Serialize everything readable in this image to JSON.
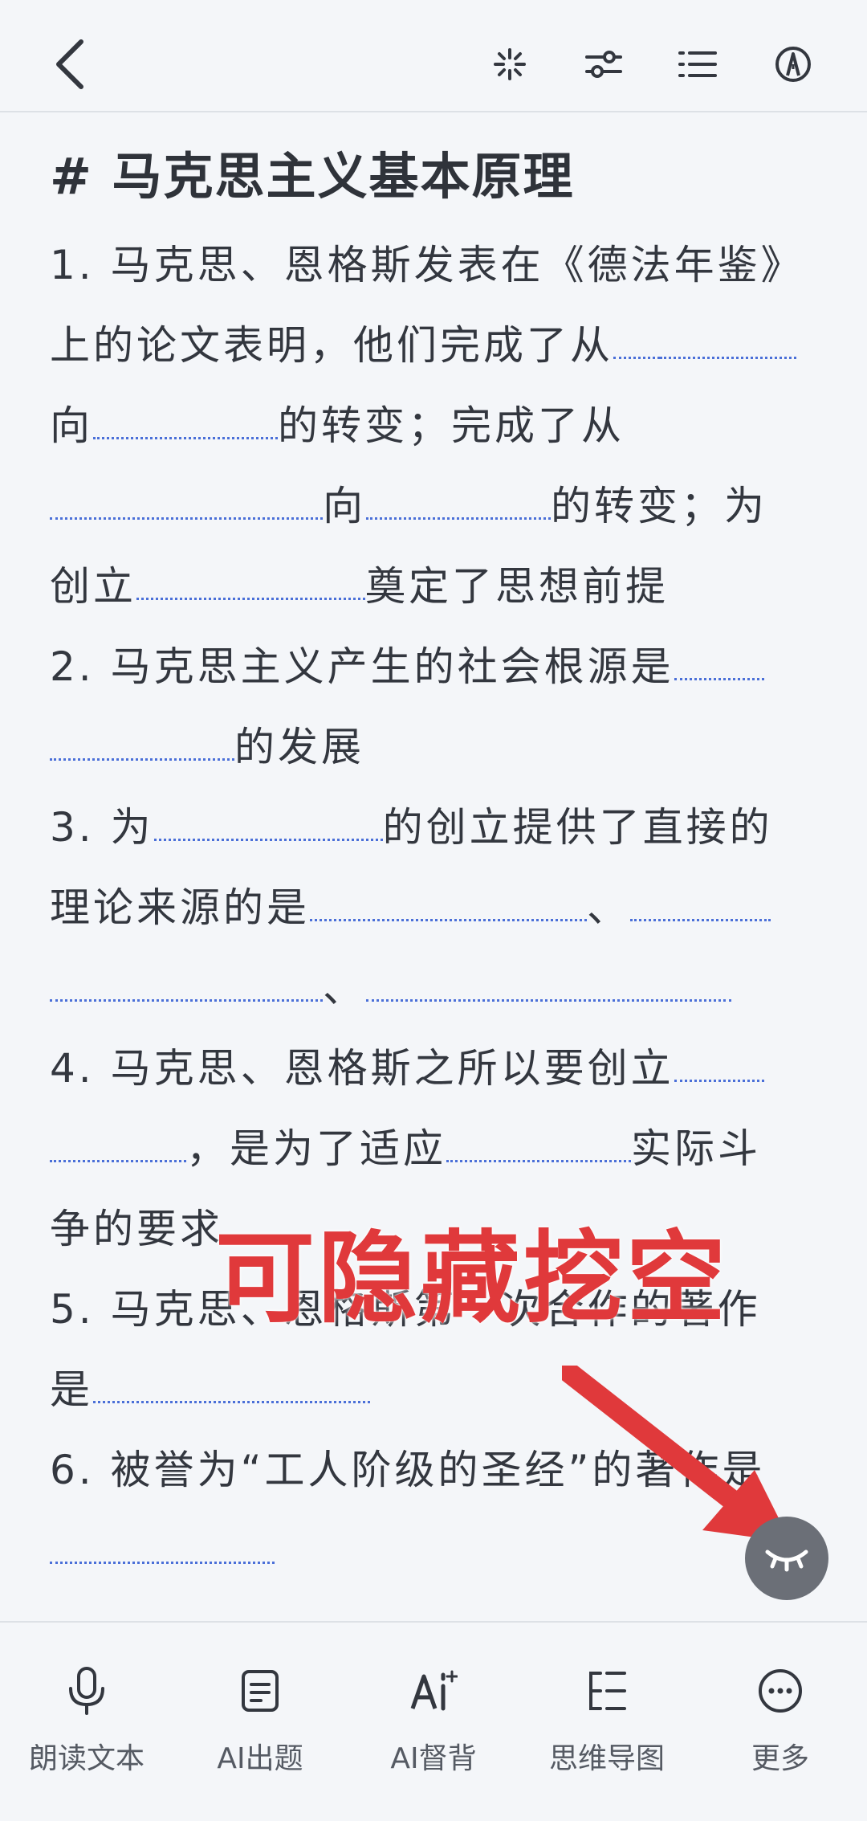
{
  "toolbar": {
    "back_icon": "chevron-left-icon",
    "icons": [
      "sparkle-icon",
      "sliders-icon",
      "list-icon",
      "pen-circle-icon"
    ]
  },
  "document": {
    "title": "# 马克思主义基本原理",
    "questions": [
      {
        "num": "1.",
        "segments": [
          "马克思、恩格斯发表在《德法年鉴》上的论文表明，他们完成了从",
          "向",
          "的转变；完成了从",
          "向",
          "的转变；为创立",
          "奠定了思想前提"
        ]
      },
      {
        "num": "2.",
        "segments": [
          "马克思主义产生的社会根源是",
          "的发展"
        ]
      },
      {
        "num": "3.",
        "segments": [
          "为",
          "的创立提供了直接的理论来源的是",
          "、",
          "、"
        ]
      },
      {
        "num": "4.",
        "segments": [
          "马克思、恩格斯之所以要创立",
          "，是为了适应",
          "实际斗争的要求"
        ]
      },
      {
        "num": "5.",
        "segments": [
          "马克思、恩格斯第一次合作的著作是"
        ]
      },
      {
        "num": "6.",
        "segments": [
          "被誉为“工人阶级的圣经”的著作是"
        ]
      }
    ]
  },
  "overlay": {
    "label": "可隐藏挖空",
    "label_color": "#e0393b",
    "fab_icon": "eye-closed-icon"
  },
  "bottom_tools": [
    {
      "icon": "microphone-icon",
      "label": "朗读文本"
    },
    {
      "icon": "document-icon",
      "label": "AI出题"
    },
    {
      "icon": "ai-text-icon",
      "label": "AI督背"
    },
    {
      "icon": "mindmap-icon",
      "label": "思维导图"
    },
    {
      "icon": "more-icon",
      "label": "更多"
    }
  ],
  "colors": {
    "background": "#f4f6f9",
    "blank_underline": "#4a6fd8",
    "text": "#33373f"
  }
}
